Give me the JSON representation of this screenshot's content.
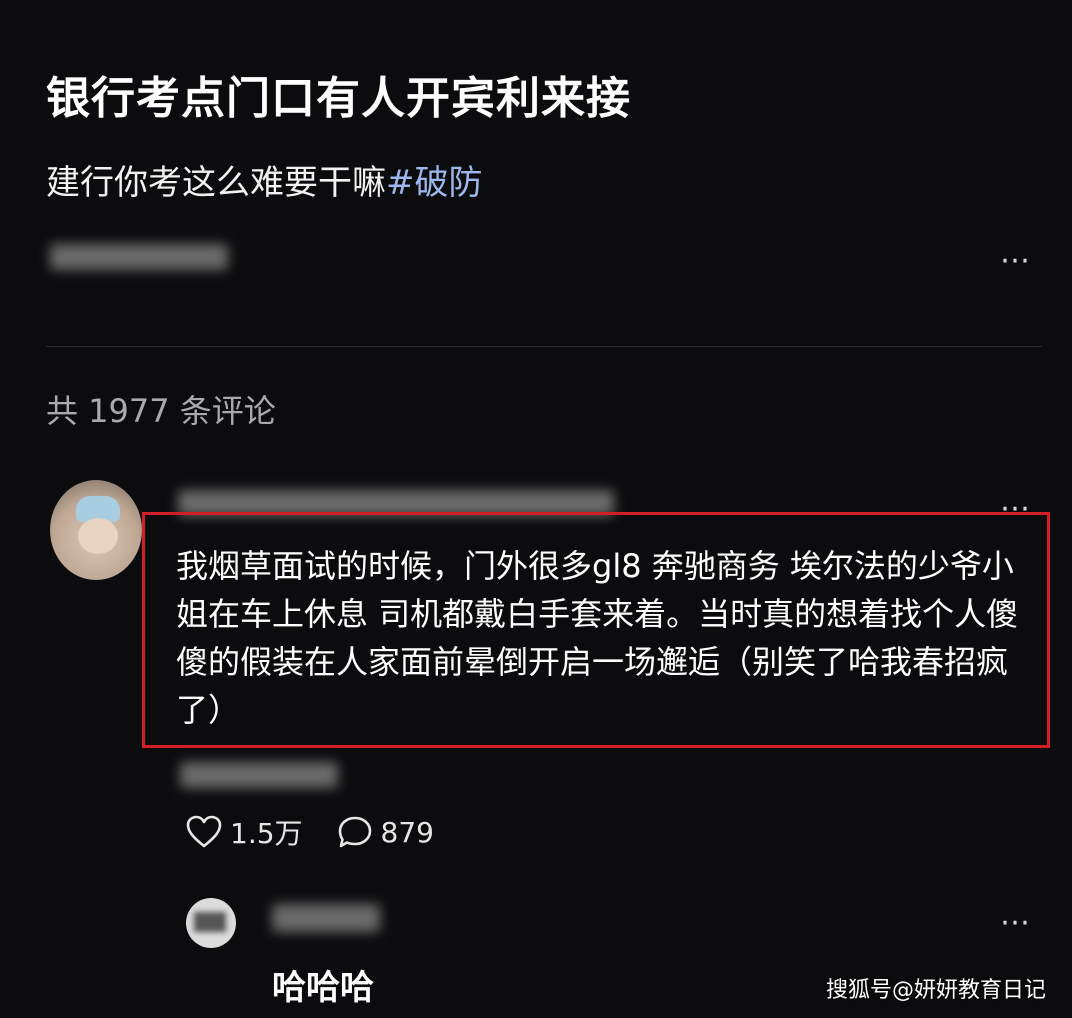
{
  "post": {
    "title": "银行考点门口有人开宾利来接",
    "body_text": "建行你考这么难要干嘛",
    "hashtag": "#破防",
    "more_icon": "more-dots-icon"
  },
  "comments": {
    "count_label": "共 1977 条评论",
    "top_comment": {
      "text": "我烟草面试的时候，门外很多gl8 奔驰商务 埃尔法的少爷小姐在车上休息 司机都戴白手套来着。当时真的想着找个人傻傻的假装在人家面前晕倒开启一场邂逅（别笑了哈我春招疯了）",
      "likes": "1.5万",
      "replies": "879",
      "like_icon": "heart-icon",
      "reply_icon": "comment-bubble-icon",
      "highlight_color": "#d21f27"
    },
    "reply": {
      "text": "哈哈哈"
    }
  },
  "watermark": "搜狐号@妍妍教育日记",
  "colors": {
    "background": "#0c0c0e",
    "hashtag": "#9cb8ec",
    "secondary_text": "#a9a9ae"
  }
}
